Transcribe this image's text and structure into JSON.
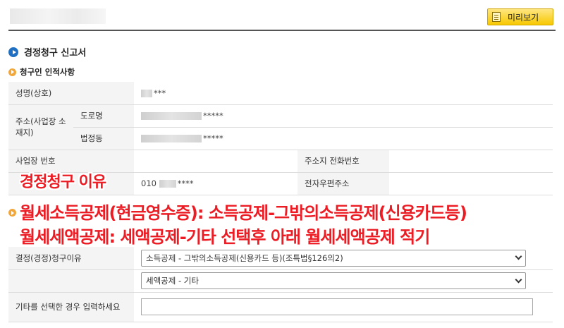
{
  "header": {
    "preview_button": "미리보기"
  },
  "section": {
    "title": "경정청구 신고서",
    "subtitle": "청구인 인적사항"
  },
  "info": {
    "name_label": "성명(상호)",
    "name_value": "***",
    "address_label": "주소(사업장 소재지)",
    "road_label": "도로명",
    "road_value": "*****",
    "legal_label": "법정동",
    "legal_value": "*****",
    "biz_no_label": "사업장 번호",
    "phone_label": "주소지 전화번호",
    "mobile_value_prefix": "010",
    "mobile_value_suffix": "****",
    "email_label": "전자우편주소"
  },
  "overlay": {
    "line1": "경정청구 이유",
    "line2": "월세소득공제(현금영수증): 소득공제-그밖의소득공제(신용카드등)",
    "line3": "월세세액공제: 세액공제-기타 선택후 아래 월세세액공제 적기"
  },
  "reason": {
    "label": "결정(경정)청구이유",
    "select1": "소득공제 - 그밖의소득공제(신용카드 등)(조특법§126의2)",
    "select2": "세액공제 - 기타",
    "other_label": "기타를 선택한 경우 입력하세요",
    "other_value": ""
  }
}
